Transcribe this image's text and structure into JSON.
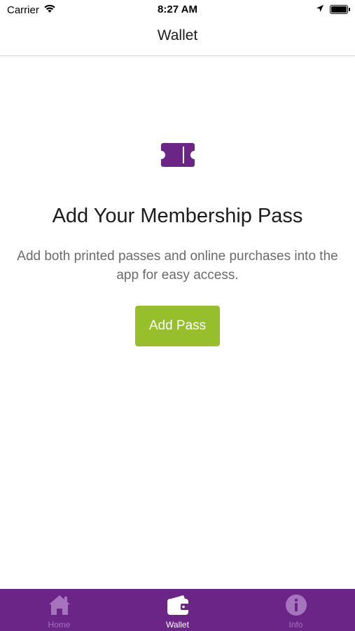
{
  "status_bar": {
    "carrier": "Carrier",
    "time": "8:27 AM"
  },
  "nav": {
    "title": "Wallet"
  },
  "empty_state": {
    "icon": "ticket-icon",
    "title": "Add Your Membership Pass",
    "description": "Add both printed passes and online purchases into the app for easy access.",
    "button_label": "Add Pass"
  },
  "tab_bar": {
    "tabs": [
      {
        "label": "Home",
        "icon": "home-icon",
        "active": false
      },
      {
        "label": "Wallet",
        "icon": "wallet-icon",
        "active": true
      },
      {
        "label": "Info",
        "icon": "info-icon",
        "active": false
      }
    ]
  },
  "colors": {
    "brand_purple": "#6b2587",
    "accent_green": "#97bf2c",
    "inactive_tab": "#a574bd",
    "active_tab": "#ffffff"
  }
}
